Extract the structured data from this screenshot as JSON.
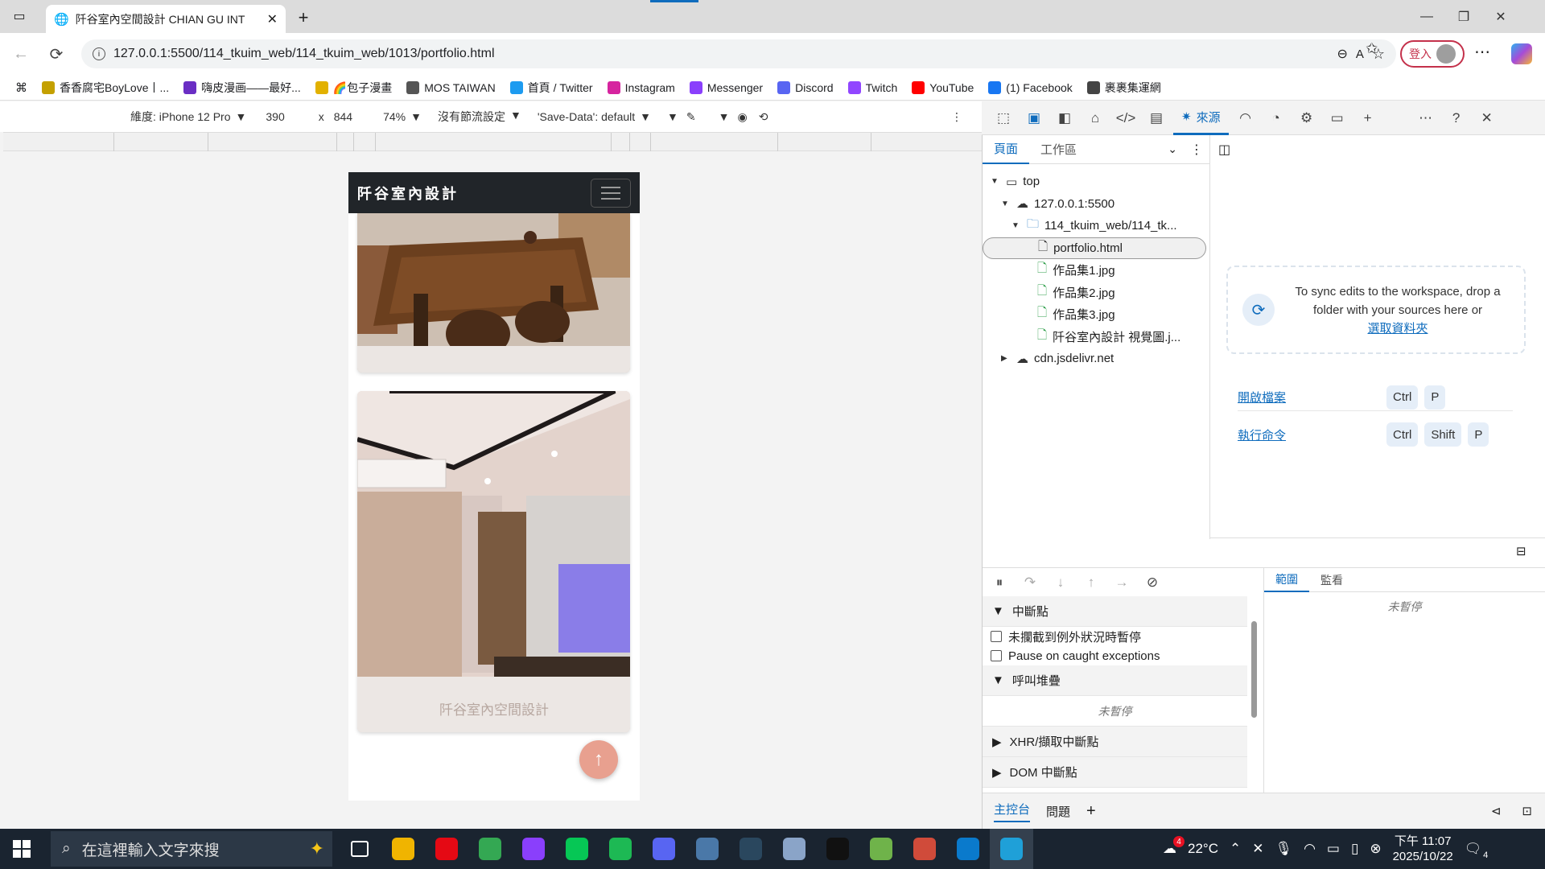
{
  "browser": {
    "tab_title": "阡谷室內空間設計 CHIAN GU INT",
    "url": "127.0.0.1:5500/114_tkuim_web/114_tkuim_web/1013/portfolio.html",
    "login_label": "登入",
    "bookmarks": [
      {
        "label": "香香腐宅BoyLove丨...",
        "color": "#c4a000",
        "icon": "app-icon"
      },
      {
        "label": "嗨皮漫画——最好...",
        "color": "#6a2ec4",
        "icon": "h-icon"
      },
      {
        "label": "🌈包子漫畫",
        "color": "#e2b100",
        "icon": "bun-icon"
      },
      {
        "label": "MOS TAIWAN",
        "color": "#555555",
        "icon": "mos-icon"
      },
      {
        "label": "首頁 / Twitter",
        "color": "#1d9bf0",
        "icon": "twitter-icon"
      },
      {
        "label": "Instagram",
        "color": "#d6249f",
        "icon": "instagram-icon"
      },
      {
        "label": "Messenger",
        "color": "#8a3ffc",
        "icon": "messenger-icon"
      },
      {
        "label": "Discord",
        "color": "#5865f2",
        "icon": "discord-icon"
      },
      {
        "label": "Twitch",
        "color": "#9146ff",
        "icon": "twitch-icon"
      },
      {
        "label": "YouTube",
        "color": "#ff0000",
        "icon": "youtube-icon"
      },
      {
        "label": "(1) Facebook",
        "color": "#1877f2",
        "icon": "facebook-icon"
      },
      {
        "label": "裹裹集運網",
        "color": "#444444",
        "icon": "globe-icon"
      }
    ]
  },
  "device_toolbar": {
    "device": "維度: iPhone 12 Pro",
    "width": "390",
    "times": "x",
    "height": "844",
    "zoom": "74%",
    "throttle": "沒有節流設定",
    "save_data": "'Save-Data': default"
  },
  "site": {
    "brand": "阡谷室內設計",
    "watermark": "阡谷室內空間設計",
    "backtop_icon": "arrow-up-icon"
  },
  "devtools": {
    "sources_tab": "來源",
    "nav_tabs": [
      "頁面",
      "工作區"
    ],
    "tree": [
      {
        "label": "top",
        "level": 0,
        "icon": "frame-icon",
        "tri": "▼"
      },
      {
        "label": "127.0.0.1:5500",
        "level": 1,
        "icon": "cloud-icon",
        "tri": "▼"
      },
      {
        "label": "114_tkuim_web/114_tk...",
        "level": 2,
        "icon": "folder-icon",
        "tri": "▼"
      },
      {
        "label": "portfolio.html",
        "level": 3,
        "icon": "file-icon",
        "tri": "",
        "selected": true
      },
      {
        "label": "作品集1.jpg",
        "level": 3,
        "icon": "image-file-icon",
        "tri": ""
      },
      {
        "label": "作品集2.jpg",
        "level": 3,
        "icon": "image-file-icon",
        "tri": ""
      },
      {
        "label": "作品集3.jpg",
        "level": 3,
        "icon": "image-file-icon",
        "tri": ""
      },
      {
        "label": "阡谷室內設計 視覺圖.j...",
        "level": 3,
        "icon": "image-file-icon",
        "tri": ""
      },
      {
        "label": "cdn.jsdelivr.net",
        "level": 1,
        "icon": "cloud-icon",
        "tri": "▶"
      }
    ],
    "sync_text": "To sync edits to the workspace, drop a folder with your sources here or",
    "sync_link": "選取資料夾",
    "shortcuts": [
      {
        "label": "開啟檔案",
        "keys": [
          "Ctrl",
          "P"
        ]
      },
      {
        "label": "執行命令",
        "keys": [
          "Ctrl",
          "Shift",
          "P"
        ]
      }
    ],
    "breakpoints_head": "中斷點",
    "cb_uncaught": "未攔截到例外狀況時暫停",
    "cb_caught": "Pause on caught exceptions",
    "callstack_head": "呼叫堆疊",
    "not_paused": "未暫停",
    "xhr_head": "XHR/擷取中斷點",
    "dom_head": "DOM 中斷點",
    "scope_tabs": [
      "範圍",
      "監看"
    ],
    "scope_not_paused": "未暫停",
    "drawer_tabs": [
      "主控台",
      "問題"
    ]
  },
  "taskbar": {
    "search_placeholder": "在這裡輸入文字來搜",
    "weather": "22°C",
    "time": "下午 11:07",
    "date": "2025/10/22",
    "notifications": "4",
    "weather_badge": "4",
    "apps": [
      {
        "name": "task-view-icon",
        "color": "#1a2430"
      },
      {
        "name": "file-explorer-icon",
        "color": "#f0b400"
      },
      {
        "name": "netflix-icon",
        "color": "#e50914"
      },
      {
        "name": "chrome-icon",
        "color": "#34a853"
      },
      {
        "name": "messenger-icon",
        "color": "#8a3ffc"
      },
      {
        "name": "line-icon",
        "color": "#06c755"
      },
      {
        "name": "spotify-icon",
        "color": "#1db954"
      },
      {
        "name": "discord-icon",
        "color": "#5865f2"
      },
      {
        "name": "app-icon",
        "color": "#4a78a8"
      },
      {
        "name": "steam-icon",
        "color": "#2a475e"
      },
      {
        "name": "cube-icon",
        "color": "#8aa4c8"
      },
      {
        "name": "capcut-icon",
        "color": "#111111"
      },
      {
        "name": "paint-icon",
        "color": "#6fb34a"
      },
      {
        "name": "chrome-icon",
        "color": "#d04b3a"
      },
      {
        "name": "vscode-icon",
        "color": "#0a7acc"
      },
      {
        "name": "edge-icon",
        "color": "#1fa0d8"
      }
    ]
  }
}
